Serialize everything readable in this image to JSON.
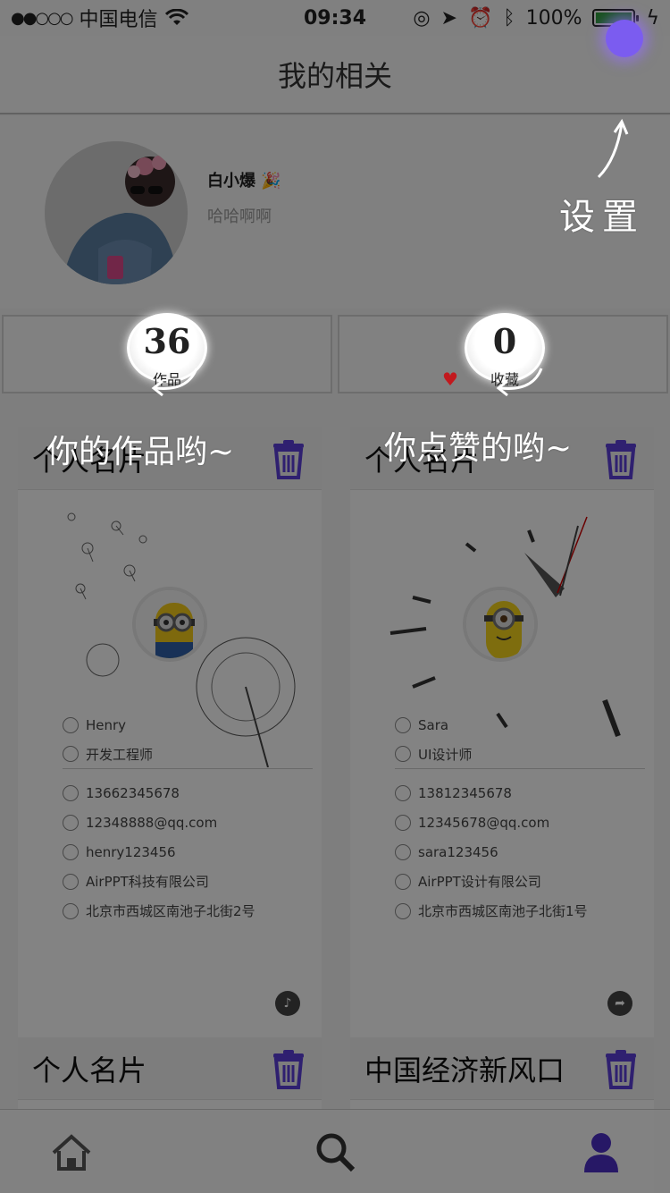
{
  "status_bar": {
    "signal_dots": "●●○○○",
    "carrier": "中国电信",
    "time": "09:34",
    "battery": "100%"
  },
  "nav": {
    "title": "我的相关"
  },
  "profile": {
    "name": "白小爆 🎉",
    "signature": "哈哈啊啊"
  },
  "stats": {
    "works_count": "36",
    "works_label": "作品",
    "fav_count": "0",
    "fav_label": "收藏"
  },
  "cards": [
    {
      "title": "个人名片",
      "name": "Henry",
      "job": "开发工程师",
      "phone": "13662345678",
      "email": "12348888@qq.com",
      "wechat": "henry123456",
      "company": "AirPPT科技有限公司",
      "address": "北京市西城区南池子北街2号"
    },
    {
      "title": "个人名片",
      "name": "Sara",
      "job": "UI设计师",
      "phone": "13812345678",
      "email": "12345678@qq.com",
      "wechat": "sara123456",
      "company": "AirPPT设计有限公司",
      "address": "北京市西城区南池子北街1号"
    }
  ],
  "bottom_cards": [
    {
      "title": "个人名片"
    },
    {
      "title": "中国经济新风口"
    }
  ],
  "guides": {
    "settings": "设置",
    "works": "你的作品哟~",
    "likes": "你点赞的哟~"
  },
  "colors": {
    "accent": "#5b3fd6",
    "settings_dot": "#7b5cf0",
    "heart": "#c2191e"
  },
  "icons": [
    "wifi-icon",
    "settings-icon",
    "trash-icon",
    "heart-icon",
    "home-icon",
    "search-icon",
    "user-icon"
  ]
}
